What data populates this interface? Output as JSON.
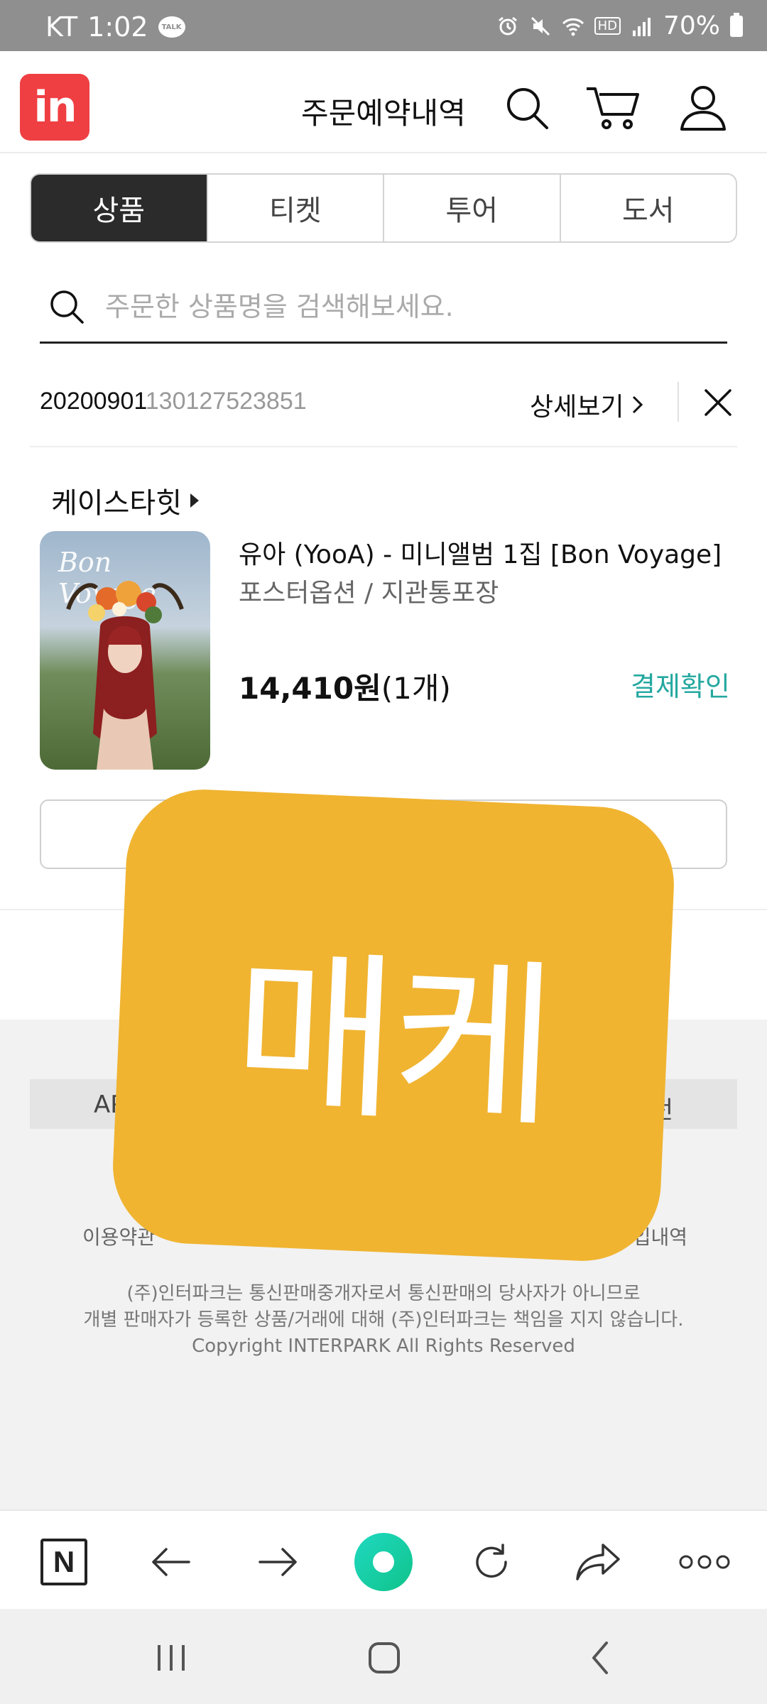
{
  "status_bar": {
    "carrier": "KT",
    "time": "1:02",
    "talk_badge": "TALK",
    "hd_label": "HD",
    "battery": "70%"
  },
  "header": {
    "logo_text": "in",
    "order_history_link": "주문예약내역",
    "icons": [
      "search-icon",
      "cart-icon",
      "user-icon"
    ]
  },
  "tabs": [
    {
      "label": "상품",
      "selected": true
    },
    {
      "label": "티켓",
      "selected": false
    },
    {
      "label": "투어",
      "selected": false
    },
    {
      "label": "도서",
      "selected": false
    }
  ],
  "search": {
    "placeholder": "주문한 상품명을 검색해보세요."
  },
  "order": {
    "number_prefix": "20200901",
    "number_suffix": "130127523851",
    "detail_link": "상세보기",
    "seller": "케이스타힛",
    "product": {
      "thumbnail_title": "Bon Voyage",
      "name": "유아 (YooA) - 미니앨범 1집 [Bon Voyage]",
      "option": "포스터옵션 / 지관통포장",
      "price": "14,410원",
      "quantity": "(1개)",
      "status": "결제확인"
    }
  },
  "footer": {
    "bar_left_fragment": "AP",
    "bar_right_fragment": "전",
    "link_left": "이용약관",
    "link_right_fragment": "입내역",
    "notice_line1": "(주)인터파크는 통신판매중개자로서 통신판매의 당사자가 아니므로",
    "notice_line2": "개별 판매자가 등록한 상품/거래에 대해 (주)인터파크는 책임을 지지 않습니다.",
    "copyright": "Copyright INTERPARK All Rights Reserved"
  },
  "sticker": {
    "text": "매케"
  },
  "browser_toolbar": {
    "naver_label": "N"
  },
  "colors": {
    "brand_red": "#ef3f43",
    "status_teal": "#24a8a0",
    "sticker_yellow": "#f0b431",
    "tab_active_bg": "#2b2b2b"
  }
}
